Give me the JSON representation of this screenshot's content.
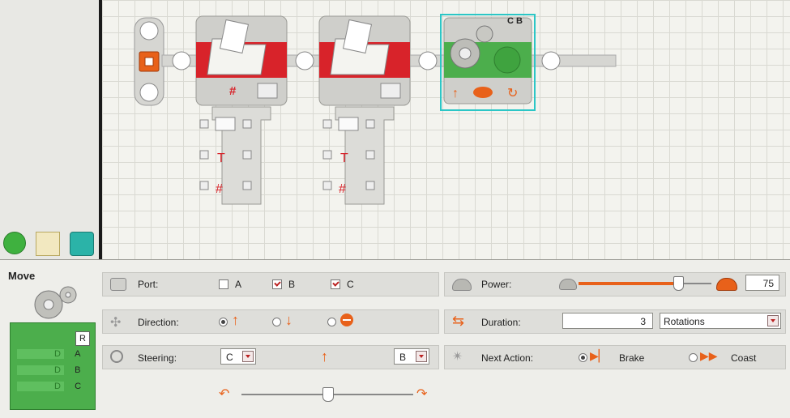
{
  "canvas": {
    "blocks": [
      {
        "name": "file-access-block-1",
        "glyphs": "#"
      },
      {
        "name": "file-access-block-2",
        "glyphs": ""
      },
      {
        "name": "move-block",
        "ports_label": "C B"
      }
    ]
  },
  "panel": {
    "title": "Move",
    "ports_box": {
      "reset_label": "R",
      "rows": [
        {
          "value": "D",
          "port": "A"
        },
        {
          "value": "D",
          "port": "B"
        },
        {
          "value": "D",
          "port": "C"
        }
      ]
    },
    "port": {
      "label": "Port:",
      "options": [
        {
          "label": "A",
          "checked": false
        },
        {
          "label": "B",
          "checked": true
        },
        {
          "label": "C",
          "checked": true
        }
      ]
    },
    "direction": {
      "label": "Direction:",
      "selected": "forward"
    },
    "steering": {
      "label": "Steering:",
      "left_port": "C",
      "right_port": "B",
      "slider_position": 0.5
    },
    "power": {
      "label": "Power:",
      "value": "75",
      "level": 0.75
    },
    "duration": {
      "label": "Duration:",
      "value": "3",
      "unit": "Rotations"
    },
    "next_action": {
      "label": "Next Action:",
      "options": [
        {
          "label": "Brake",
          "selected": true
        },
        {
          "label": "Coast",
          "selected": false
        }
      ]
    },
    "colors": {
      "accent_red": "#d8232a",
      "accent_orange": "#e8611a",
      "move_green": "#4cae4c",
      "selection_cyan": "#2cc6c6"
    }
  }
}
